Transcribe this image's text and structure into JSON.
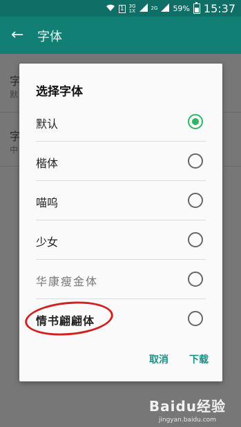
{
  "status_bar": {
    "wifi_icon": "wifi-icon",
    "sim_badge": "1",
    "net1": "3G\n1X",
    "net2": "2G",
    "battery": "59%",
    "time": "15:37"
  },
  "app_bar": {
    "back_icon": "arrow-left-icon",
    "title": "字体"
  },
  "background": {
    "item1": {
      "title": "字",
      "sub": "默"
    },
    "item2": {
      "title": "字",
      "sub": "中"
    }
  },
  "dialog": {
    "title": "选择字体",
    "options": [
      {
        "label": "默认",
        "selected": true
      },
      {
        "label": "楷体",
        "selected": false
      },
      {
        "label": "喵呜",
        "selected": false
      },
      {
        "label": "少女",
        "selected": false
      },
      {
        "label": "华康瘦金体",
        "selected": false
      },
      {
        "label": "情书翩翩体",
        "selected": false
      }
    ],
    "cancel": "取消",
    "download": "下载"
  },
  "watermark": {
    "logo": "Baidu经验",
    "url": "jingyan.baidu.com"
  },
  "colors": {
    "accent": "#2fb565",
    "appbar": "#127f74",
    "annotation": "#d32020"
  }
}
